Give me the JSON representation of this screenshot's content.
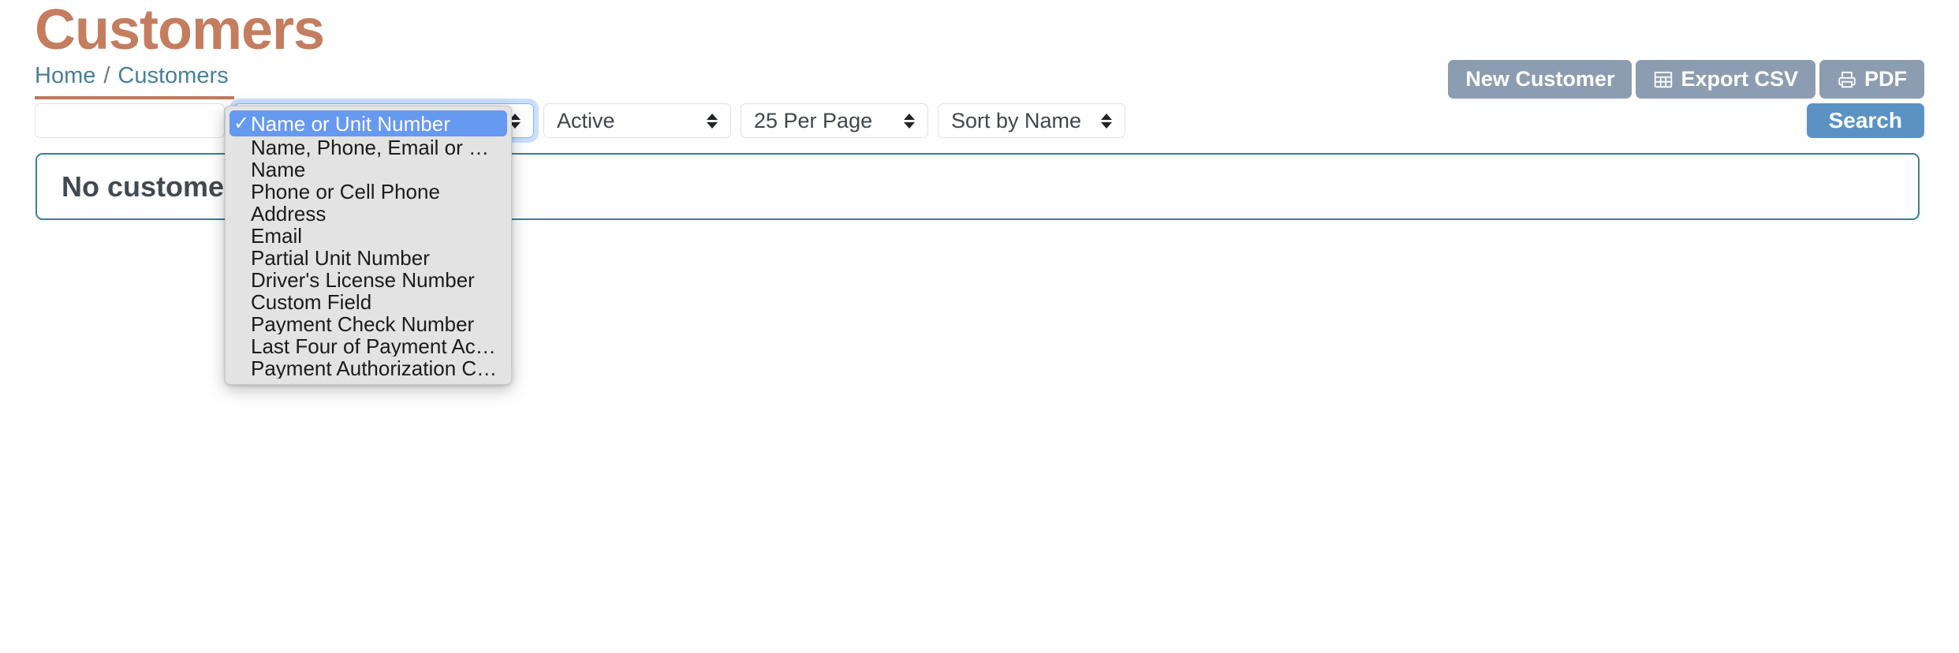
{
  "header": {
    "title": "Customers",
    "breadcrumb": {
      "home": "Home",
      "separator": "/",
      "current": "Customers"
    },
    "accent_color": "#c47d5e",
    "link_color": "#4a7f96"
  },
  "actions": [
    {
      "label": "New Customer",
      "icon": "",
      "name": "new-customer-button"
    },
    {
      "label": "Export CSV",
      "icon": "table-icon",
      "name": "export-csv-button"
    },
    {
      "label": "PDF",
      "icon": "printer-icon",
      "name": "pdf-button"
    }
  ],
  "action_button_color": "#8d9db1",
  "filters": {
    "search_input": {
      "value": "",
      "placeholder": ""
    },
    "search_type": {
      "value": "Name or Unit Number",
      "focused": true
    },
    "status": {
      "value": "Active"
    },
    "per_page": {
      "value": "25 Per Page"
    },
    "sort": {
      "value": "Sort by Name"
    },
    "search_button": {
      "label": "Search",
      "color": "#5b92c4"
    }
  },
  "alert": {
    "message": "No customers found",
    "border_color": "#3b7f98"
  },
  "dropdown": {
    "open": true,
    "selected_index": 0,
    "highlight_color": "#6699f0",
    "background_color": "#e3e3e3",
    "check_glyph": "✓",
    "options": [
      "Name or Unit Number",
      "Name, Phone, Email or Unit Number",
      "Name",
      "Phone or Cell Phone",
      "Address",
      "Email",
      "Partial Unit Number",
      "Driver's License Number",
      "Custom Field",
      "Payment Check Number",
      "Last Four of Payment Account",
      "Payment Authorization Code"
    ]
  }
}
